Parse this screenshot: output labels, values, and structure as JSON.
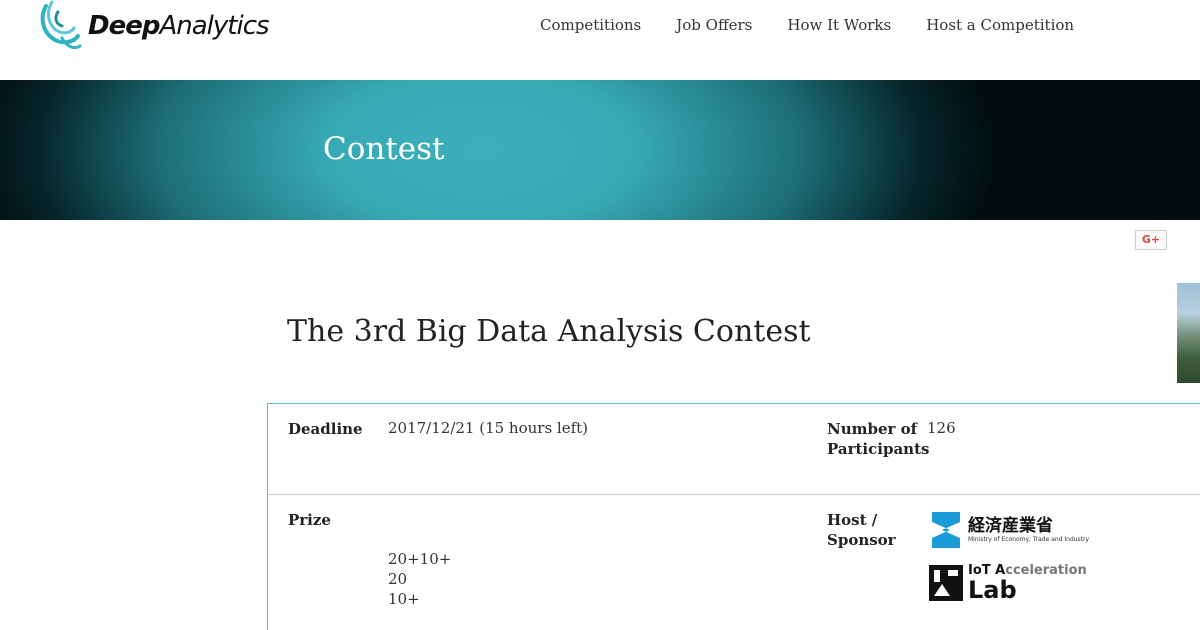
{
  "header": {
    "logo_text_bold": "Deep",
    "logo_text_light": "Analytics",
    "nav": [
      {
        "label": "Competitions"
      },
      {
        "label": "Job Offers"
      },
      {
        "label": "How It Works"
      },
      {
        "label": "Host a Competition"
      }
    ]
  },
  "banner": {
    "title": "Contest"
  },
  "share": {
    "gplus_label": "G+"
  },
  "contest": {
    "title": "The 3rd Big Data Analysis Contest",
    "deadline_label": "Deadline",
    "deadline_value": "2017/12/21 (15 hours left)",
    "participants_label": "Number of Participants",
    "participants_value": "126",
    "prize_label": "Prize",
    "prizes": [
      "20+10+",
      "20",
      "10+"
    ],
    "host_label": "Host / Sponsor",
    "sponsors": {
      "meti_jp": "経済産業省",
      "meti_en": "Ministry of Economy, Trade and Industry",
      "iot_prefix": "IoT A",
      "iot_accel": "cceleration",
      "iot_lab": "Lab"
    }
  },
  "colors": {
    "accent": "#3bb0bb",
    "table_border": "#5bbfc7",
    "meti_blue": "#1a9bd7",
    "gplus_red": "#dd4b39"
  }
}
